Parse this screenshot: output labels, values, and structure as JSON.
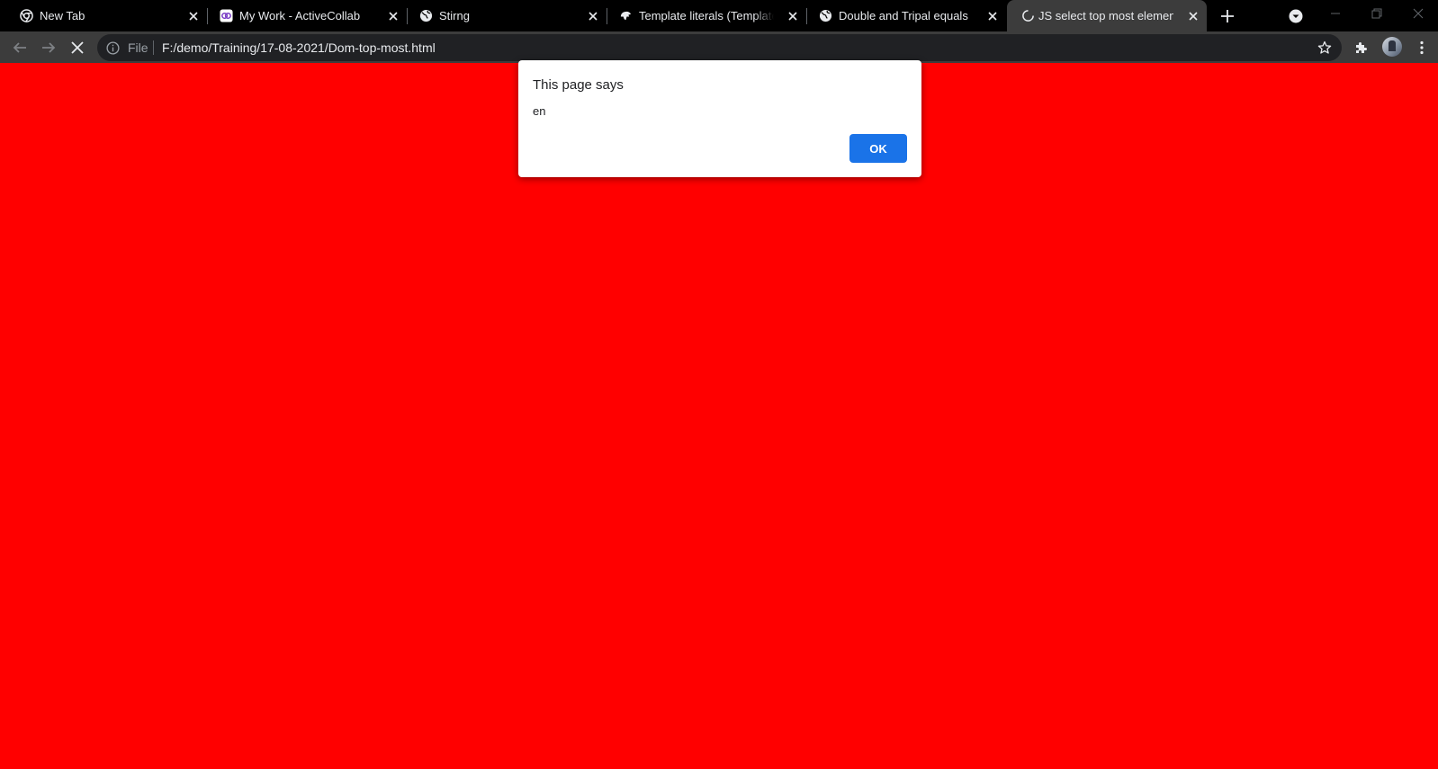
{
  "tabs": [
    {
      "title": "New Tab",
      "favicon": "chrome-icon"
    },
    {
      "title": "My Work - ActiveCollab",
      "favicon": "activecollab-icon"
    },
    {
      "title": "Stirng",
      "favicon": "globe-icon"
    },
    {
      "title": "Template literals (Template strings)",
      "favicon": "mdn-dino-icon"
    },
    {
      "title": "Double and Tripal equals",
      "favicon": "globe-icon"
    },
    {
      "title": "JS select top most element",
      "favicon": "loading-spinner-icon",
      "active": true
    }
  ],
  "toolbar": {
    "scheme_label": "File",
    "url": "F:/demo/Training/17-08-2021/Dom-top-most.html"
  },
  "dialog": {
    "title": "This page says",
    "message": "en",
    "ok_label": "OK"
  },
  "colors": {
    "page_background": "#ff0000",
    "accent": "#1a73e8",
    "tabstrip": "#000000",
    "toolbar": "#3c3c3c"
  },
  "icons": [
    "new-tab-icon",
    "tab-search-icon",
    "minimize-icon",
    "maximize-icon",
    "window-close-icon",
    "back-icon",
    "forward-icon",
    "stop-icon",
    "info-icon",
    "star-icon",
    "extensions-icon",
    "avatar",
    "menu-icon"
  ]
}
